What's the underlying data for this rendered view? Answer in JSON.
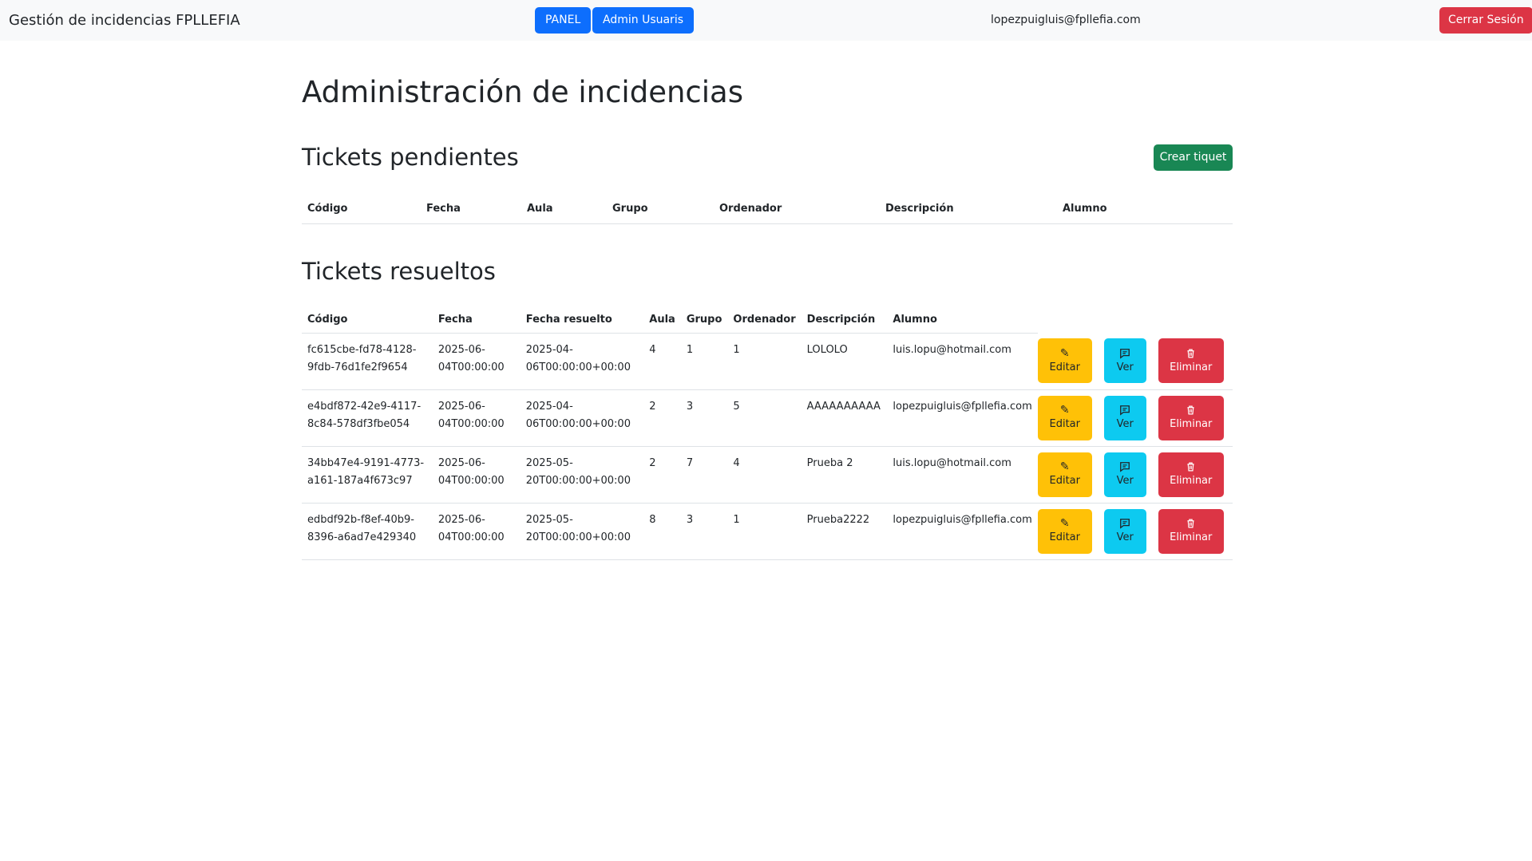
{
  "navbar": {
    "brand": "Gestión de incidencias FPLLEFIA",
    "panel_label": "PANEL",
    "admin_label": "Admin Usuaris",
    "user_email": "lopezpuigluis@fpllefia.com",
    "logout_label": "Cerrar Sesión"
  },
  "page": {
    "title": "Administración de incidencias"
  },
  "pending": {
    "title": "Tickets pendientes",
    "create_label": "Crear tiquet",
    "headers": [
      "Código",
      "Fecha",
      "Aula",
      "Grupo",
      "Ordenador",
      "Descripción",
      "Alumno"
    ]
  },
  "resolved": {
    "title": "Tickets resueltos",
    "headers": [
      "Código",
      "Fecha",
      "Fecha resuelto",
      "Aula",
      "Grupo",
      "Ordenador",
      "Descripción",
      "Alumno"
    ],
    "actions": {
      "edit_label": "Editar",
      "view_label": "Ver",
      "delete_label": "Eliminar",
      "edit_icon": "pencil-icon",
      "view_icon": "chat-icon",
      "delete_icon": "trash-icon"
    },
    "rows": [
      {
        "code_1": "fc615cbe-fd78-4128-",
        "code_2": "9fdb-76d1fe2f9654",
        "date_1": "2025-06-",
        "date_2": "04T00:00:00",
        "resolved_1": "2025-04-",
        "resolved_2": "06T00:00:00+00:00",
        "aula": "4",
        "grupo": "1",
        "ordenador": "1",
        "descripcion": "LOLOLO",
        "alumno": "luis.lopu@hotmail.com"
      },
      {
        "code_1": "e4bdf872-42e9-4117-",
        "code_2": "8c84-578df3fbe054",
        "date_1": "2025-06-",
        "date_2": "04T00:00:00",
        "resolved_1": "2025-04-",
        "resolved_2": "06T00:00:00+00:00",
        "aula": "2",
        "grupo": "3",
        "ordenador": "5",
        "descripcion": "AAAAAAAAAA",
        "alumno": "lopezpuigluis@fpllefia.com"
      },
      {
        "code_1": "34bb47e4-9191-4773-",
        "code_2": "a161-187a4f673c97",
        "date_1": "2025-06-",
        "date_2": "04T00:00:00",
        "resolved_1": "2025-05-",
        "resolved_2": "20T00:00:00+00:00",
        "aula": "2",
        "grupo": "7",
        "ordenador": "4",
        "descripcion": "Prueba 2",
        "alumno": "luis.lopu@hotmail.com"
      },
      {
        "code_1": "edbdf92b-f8ef-40b9-",
        "code_2": "8396-a6ad7e429340",
        "date_1": "2025-06-",
        "date_2": "04T00:00:00",
        "resolved_1": "2025-05-",
        "resolved_2": "20T00:00:00+00:00",
        "aula": "8",
        "grupo": "3",
        "ordenador": "1",
        "descripcion": "Prueba2222",
        "alumno": "lopezpuigluis@fpllefia.com"
      }
    ]
  },
  "colors": {
    "primary": "#0d6efd",
    "danger": "#dc3545",
    "success": "#198754",
    "warning": "#ffc107",
    "info": "#0dcaf0",
    "navbar_bg": "#f8f9fa"
  }
}
